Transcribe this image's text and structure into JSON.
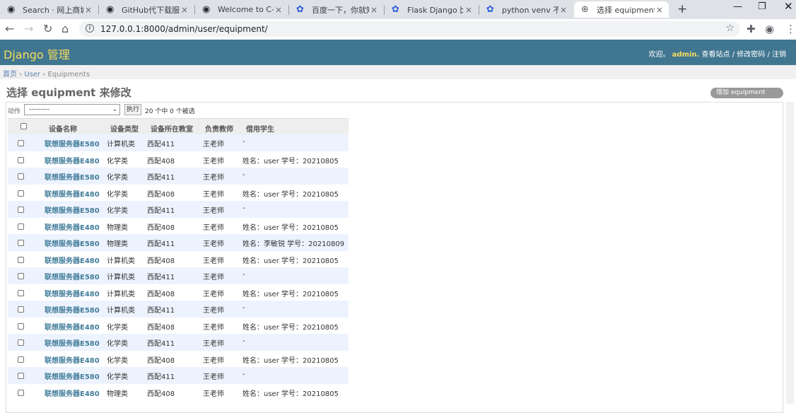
{
  "browser": {
    "tabs": [
      {
        "title": "Search · 网上商城",
        "icon": "github-icon",
        "active": false
      },
      {
        "title": "GitHub代下载服务",
        "icon": "github-icon",
        "active": false
      },
      {
        "title": "Welcome to C-L",
        "icon": "github-icon",
        "active": false
      },
      {
        "title": "百度一下，你就知",
        "icon": "baidu-paw-icon",
        "active": false
      },
      {
        "title": "Flask Django 比",
        "icon": "baidu-paw-icon",
        "active": false
      },
      {
        "title": "python venv 不",
        "icon": "baidu-paw-icon",
        "active": false
      },
      {
        "title": "选择 equipment",
        "icon": "globe-icon",
        "active": true
      }
    ],
    "close_glyph": "×",
    "new_tab_glyph": "+",
    "url": "127.0.0.1:8000/admin/user/equipment/",
    "colors": {
      "tabstrip": "#dee1e6",
      "omnibox": "#f1f3f4"
    }
  },
  "header": {
    "brand": "Django 管理",
    "welcome": "欢迎。",
    "username": "admin.",
    "view_site": "查看站点",
    "sep": "/",
    "change_password": "修改密码",
    "logout": "注销",
    "colors": {
      "bar": "#417690",
      "brand": "#f5dd5d"
    }
  },
  "breadcrumbs": {
    "home": "首页",
    "sep": "›",
    "app": "User",
    "model": "Equipments"
  },
  "page": {
    "title": "选择 equipment 来修改",
    "add_button": "增加 equipment"
  },
  "actions": {
    "label": "动作",
    "select_value": "---------",
    "go_button": "执行",
    "selected_count": "20 个中 0 个被选"
  },
  "table": {
    "columns": [
      "设备名称",
      "设备类型",
      "设备所在教室",
      "负责教师",
      "借用学生"
    ],
    "rows": [
      [
        "联想服务器E580",
        "计算机类",
        "西配411",
        "王老师",
        "-"
      ],
      [
        "联想服务器E480",
        "化学类",
        "西配408",
        "王老师",
        "姓名：user 学号：20210805"
      ],
      [
        "联想服务器E580",
        "化学类",
        "西配411",
        "王老师",
        "-"
      ],
      [
        "联想服务器E480",
        "化学类",
        "西配408",
        "王老师",
        "姓名：user 学号：20210805"
      ],
      [
        "联想服务器E580",
        "化学类",
        "西配411",
        "王老师",
        "-"
      ],
      [
        "联想服务器E480",
        "物理类",
        "西配408",
        "王老师",
        "姓名：user 学号：20210805"
      ],
      [
        "联想服务器E580",
        "物理类",
        "西配411",
        "王老师",
        "姓名：李敏锐 学号：20210809"
      ],
      [
        "联想服务器E480",
        "计算机类",
        "西配408",
        "王老师",
        "姓名：user 学号：20210805"
      ],
      [
        "联想服务器E580",
        "计算机类",
        "西配411",
        "王老师",
        "-"
      ],
      [
        "联想服务器E480",
        "计算机类",
        "西配408",
        "王老师",
        "姓名：user 学号：20210805"
      ],
      [
        "联想服务器E580",
        "计算机类",
        "西配411",
        "王老师",
        "-"
      ],
      [
        "联想服务器E480",
        "化学类",
        "西配408",
        "王老师",
        "姓名：user 学号：20210805"
      ],
      [
        "联想服务器E580",
        "化学类",
        "西配411",
        "王老师",
        "-"
      ],
      [
        "联想服务器E480",
        "化学类",
        "西配408",
        "王老师",
        "姓名：user 学号：20210805"
      ],
      [
        "联想服务器E580",
        "化学类",
        "西配411",
        "王老师",
        "-"
      ],
      [
        "联想服务器E480",
        "物理类",
        "西配408",
        "王老师",
        "姓名：user 学号：20210805"
      ]
    ],
    "colors": {
      "link": "#447e9b",
      "alt_row": "#edf3fe",
      "header": "#eeeeee"
    }
  }
}
